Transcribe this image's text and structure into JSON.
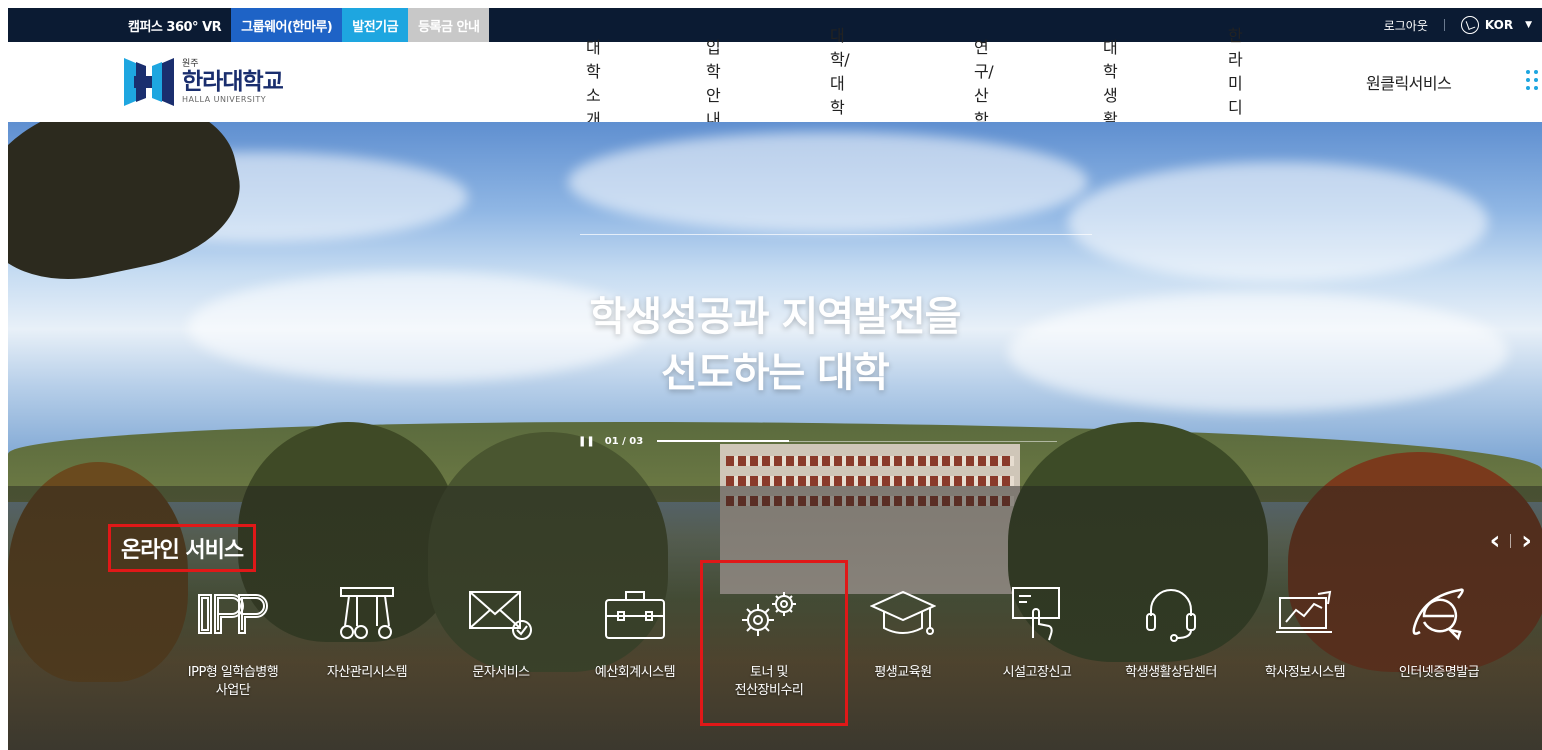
{
  "utility_bar": {
    "tabs": [
      {
        "label": "캠퍼스 360° VR",
        "bg": "#0b1b33"
      },
      {
        "label": "그룹웨어(한마루)",
        "bg": "#1e63c6"
      },
      {
        "label": "발전기금",
        "bg": "#1ea6e0"
      },
      {
        "label": "등록금 안내",
        "bg": "#c8c8c8"
      }
    ],
    "logout": "로그아웃",
    "language": "KOR"
  },
  "header": {
    "logo_sub": "원주",
    "logo_name": "한라대학교",
    "logo_eng": "HALLA UNIVERSITY",
    "nav": [
      "대학소개",
      "입학안내",
      "대학/대학원",
      "연구/산학",
      "대학생활",
      "한라미디어",
      "원클릭서비스"
    ]
  },
  "hero": {
    "title_line1": "학생성공과 지역발전을",
    "title_line2": "선도하는 대학",
    "pager": "01 / 03",
    "progress": 0.33
  },
  "online_service": {
    "title": "온라인 서비스",
    "items": [
      {
        "label1": "IPP형 일학습병행",
        "label2": "사업단",
        "icon": "ipp-icon"
      },
      {
        "label1": "자산관리시스템",
        "label2": "",
        "icon": "asset-management-icon"
      },
      {
        "label1": "문자서비스",
        "label2": "",
        "icon": "envelope-check-icon"
      },
      {
        "label1": "예산회계시스템",
        "label2": "",
        "icon": "briefcase-icon"
      },
      {
        "label1": "토너 및",
        "label2": "전산장비수리",
        "icon": "gears-icon"
      },
      {
        "label1": "평생교육원",
        "label2": "",
        "icon": "graduation-cap-icon"
      },
      {
        "label1": "시설고장신고",
        "label2": "",
        "icon": "touch-screen-icon"
      },
      {
        "label1": "학생생활상담센터",
        "label2": "",
        "icon": "headset-icon"
      },
      {
        "label1": "학사정보시스템",
        "label2": "",
        "icon": "chart-monitor-icon"
      },
      {
        "label1": "인터넷증명발급",
        "label2": "",
        "icon": "internet-explorer-icon"
      }
    ]
  },
  "colors": {
    "navy": "#0b1b33",
    "highlight": "#e01818",
    "accent": "#1ea6e0"
  }
}
